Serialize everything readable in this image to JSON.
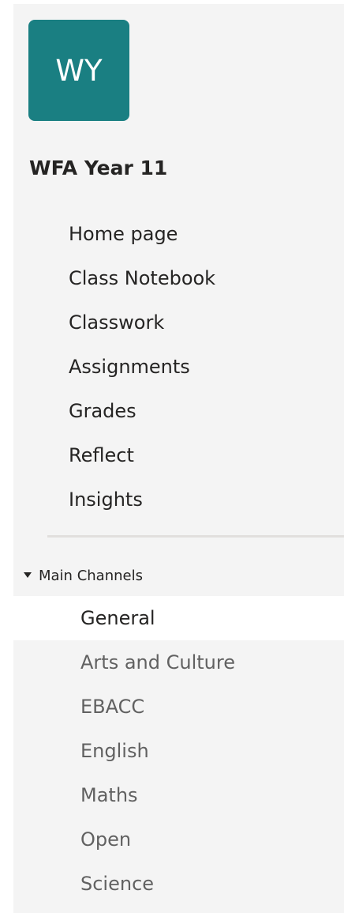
{
  "team": {
    "initials": "WY",
    "name": "WFA Year 11",
    "color": "#1a7f82"
  },
  "nav": {
    "items": [
      {
        "label": "Home page"
      },
      {
        "label": "Class Notebook"
      },
      {
        "label": "Classwork"
      },
      {
        "label": "Assignments"
      },
      {
        "label": "Grades"
      },
      {
        "label": "Reflect"
      },
      {
        "label": "Insights"
      }
    ]
  },
  "channels": {
    "section_label": "Main Channels",
    "items": [
      {
        "label": "General",
        "selected": true
      },
      {
        "label": "Arts and Culture"
      },
      {
        "label": "EBACC"
      },
      {
        "label": "English"
      },
      {
        "label": "Maths"
      },
      {
        "label": "Open"
      },
      {
        "label": "Science"
      }
    ]
  }
}
